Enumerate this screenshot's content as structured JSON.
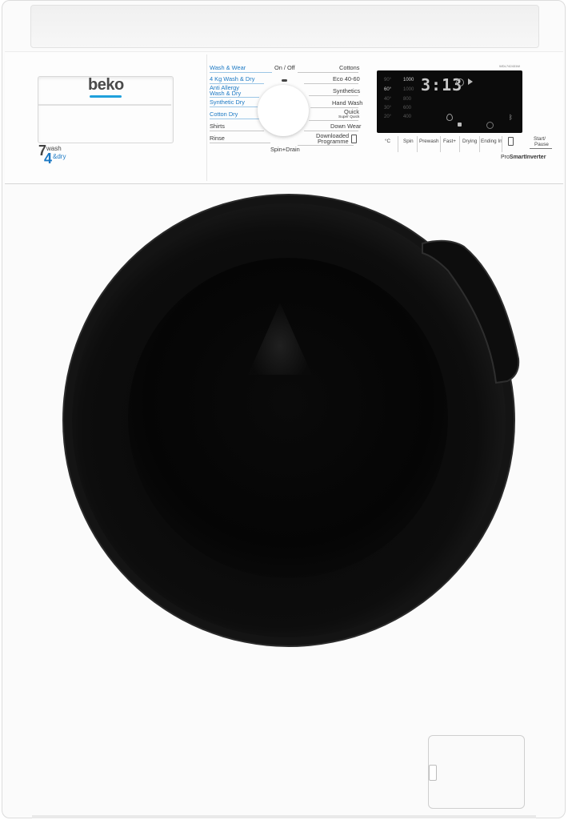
{
  "brand": {
    "logo_text": "beko",
    "accent_color": "#1fa0dc"
  },
  "capacity": {
    "wash_kg": "7",
    "wash_label": "wash",
    "dry_kg": "4",
    "dry_label": "&dry"
  },
  "programmes_left": [
    "Wash & Wear",
    "4 Kg Wash & Dry",
    "Anti Allergy",
    "Wash & Dry",
    "Synthetic Dry",
    "Cotton Dry",
    "Shirts",
    "Rinse"
  ],
  "programmes_right": [
    "Cottons",
    "Eco 40-60",
    "Synthetics",
    "Hand Wash",
    "Quick",
    "Super Quick",
    "Down Wear",
    "Downloaded",
    "Programme"
  ],
  "knob": {
    "top_label": "On / Off",
    "bottom_label": "Spin+Drain"
  },
  "display": {
    "model": "WDL742431W",
    "time": "3:13",
    "temps": [
      "90°",
      "60°",
      "40°",
      "30°",
      "20°"
    ],
    "spins": [
      "1000",
      "1000",
      "800",
      "600",
      "400"
    ]
  },
  "buttons": [
    "°C",
    "Spin",
    "Prewash",
    "Fast+",
    "Drying",
    "Ending In",
    "Start/",
    "Pause"
  ],
  "inverter": {
    "prefix": "Pro",
    "bold": "SmartInverter"
  },
  "colors": {
    "body": "#fbfbfb",
    "door": "#0b0b0b",
    "programme_text_blue": "#1c79c4",
    "programme_text_grey": "#3a3a3a"
  }
}
